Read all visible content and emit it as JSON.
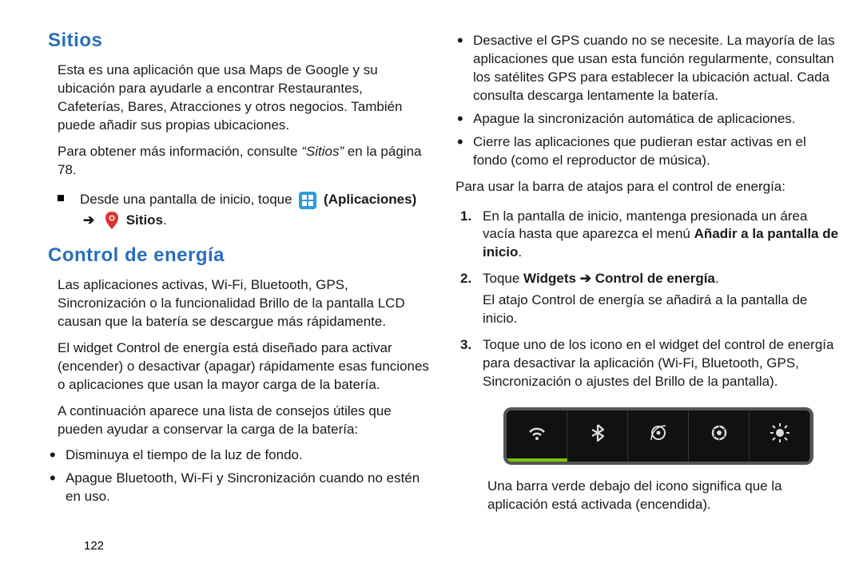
{
  "left": {
    "heading1": "Sitios",
    "p1": "Esta es una aplicación que usa Maps de Google y su ubicación para ayudarle a encontrar Restaurantes, Cafeterías, Bares, Atracciones y otros negocios. También puede añadir sus propias ubicaciones.",
    "p2a": "Para obtener más información, consulte ",
    "p2_italic": "“Sitios”",
    "p2b": " en la página 78.",
    "sq_line1a": "Desde una pantalla de inicio, toque ",
    "sq_label1": " (Aplicaciones)",
    "sq_arrow": "➔",
    "sq_label2": " Sitios",
    "sq_period": ".",
    "heading2": "Control de energía",
    "p3": "Las aplicaciones activas, Wi-Fi, Bluetooth, GPS, Sincronización o la funcionalidad Brillo de la pantalla LCD causan que la batería se descargue más rápidamente.",
    "p4": "El widget Control de energía está diseñado para activar (encender) o desactivar (apagar) rápidamente esas funciones o aplicaciones que usan la mayor carga de la batería.",
    "p5": "A continuación aparece una lista de consejos útiles que pueden ayudar a conservar la carga de la batería:",
    "bul1": "Disminuya el tiempo de la luz de fondo.",
    "bul2": "Apague Bluetooth, Wi-Fi y Sincronización cuando no estén en uso."
  },
  "right": {
    "bul3": "Desactive el GPS cuando no se necesite. La mayoría de las aplicaciones que usan esta función regularmente, consultan los satélites GPS para establecer la ubicación actual. Cada consulta descarga lentamente la batería.",
    "bul4": "Apague la sincronización automática de aplicaciones.",
    "bul5": "Cierre las aplicaciones que pudieran estar activas en el fondo (como el reproductor de música).",
    "p6": "Para usar la barra de atajos para el control de energía:",
    "n1a": "En la pantalla de inicio, mantenga presionada un área vacía hasta que aparezca el menú ",
    "n1b": "Añadir a la pantalla de inicio",
    "n1c": ".",
    "n2a": "Toque ",
    "n2b": "Widgets ➔ Control de energía",
    "n2c": ".",
    "n2sub": "El atajo Control de energía se añadirá a la pantalla de inicio.",
    "n3": "Toque uno de los icono en el widget del control de energía para desactivar la aplicación (Wi-Fi, Bluetooth, GPS, Sincronización o ajustes del Brillo de la pantalla).",
    "caption": "Una barra verde debajo del icono significa que la aplicación está activada (encendida).",
    "widget": {
      "icons": [
        "wifi-icon",
        "bluetooth-icon",
        "gps-icon",
        "sync-icon",
        "brightness-icon"
      ],
      "active_index": 0,
      "accent": "#7ac700"
    }
  },
  "page_number": "122"
}
